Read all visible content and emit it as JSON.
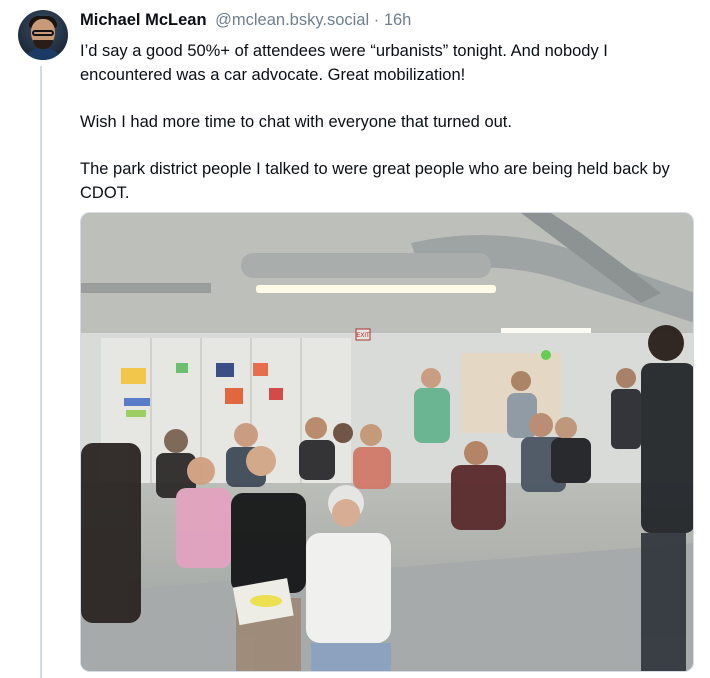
{
  "post": {
    "author_name": "Michael McLean",
    "author_handle": "@mclean.bsky.social",
    "separator": "·",
    "timestamp": "16h",
    "paragraphs": [
      "I’d say a good 50%+ of attendees were “urbanists” tonight. And nobody I encountered was a car advocate. Great mobilization!",
      "Wish I had more time to chat with everyone that turned out.",
      "The park district people I talked to were great people who are being held back by CDOT."
    ],
    "image_sign_text": "EXIT"
  },
  "colors": {
    "text": "#0b0f14",
    "muted": "#6f7f90",
    "thread_line": "#d4dbe2"
  },
  "icons": [
    "avatar-image",
    "photo-attachment"
  ]
}
